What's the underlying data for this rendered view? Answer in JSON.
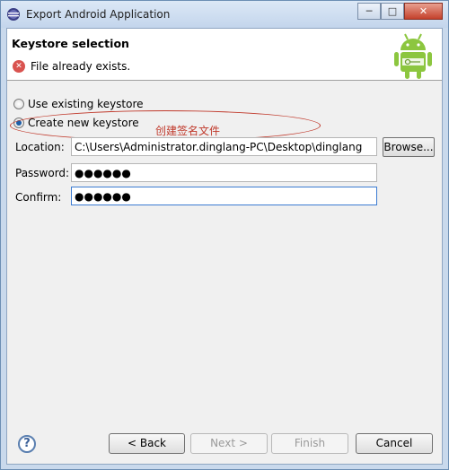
{
  "window": {
    "title": "Export Android Application",
    "minimize_label": "─",
    "maximize_label": "□",
    "close_label": "✕"
  },
  "banner": {
    "title": "Keystore selection",
    "message": "File already exists.",
    "error_icon": "error-icon",
    "logo": "android-logo"
  },
  "options": {
    "use_existing": "Use existing keystore",
    "create_new": "Create new keystore",
    "selected": "create_new"
  },
  "annotation": {
    "text": "创建签名文件",
    "color": "#c0392b"
  },
  "form": {
    "location_label": "Location:",
    "location_value": "C:\\Users\\Administrator.dinglang-PC\\Desktop\\dinglang",
    "browse_label": "Browse...",
    "password_label": "Password:",
    "password_value": "●●●●●●",
    "confirm_label": "Confirm:",
    "confirm_value": "●●●●●●"
  },
  "footer": {
    "help": "?",
    "back": "< Back",
    "next": "Next >",
    "finish": "Finish",
    "cancel": "Cancel"
  }
}
